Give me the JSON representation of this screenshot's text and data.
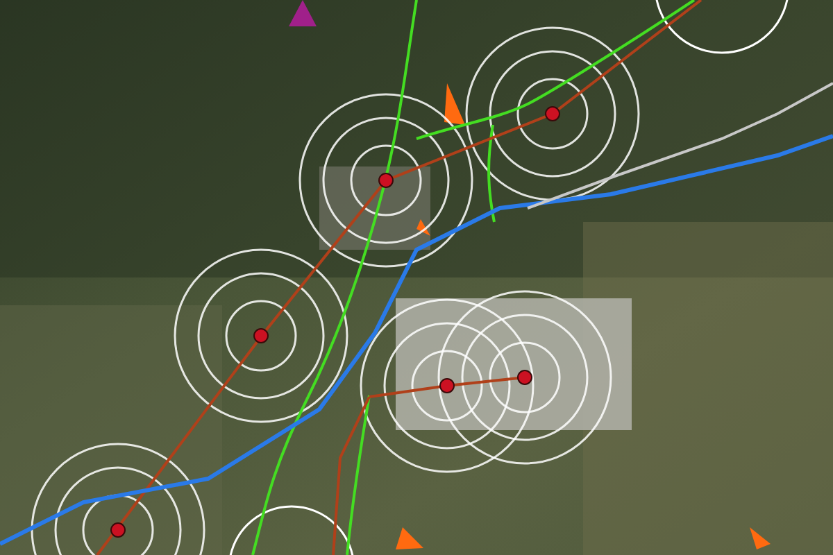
{
  "map": {
    "routes": [
      {
        "color": "#44dd22"
      },
      {
        "color": "#b0401a"
      },
      {
        "color": "#2a7ae8"
      },
      {
        "color": "#c8c8c8"
      }
    ]
  }
}
